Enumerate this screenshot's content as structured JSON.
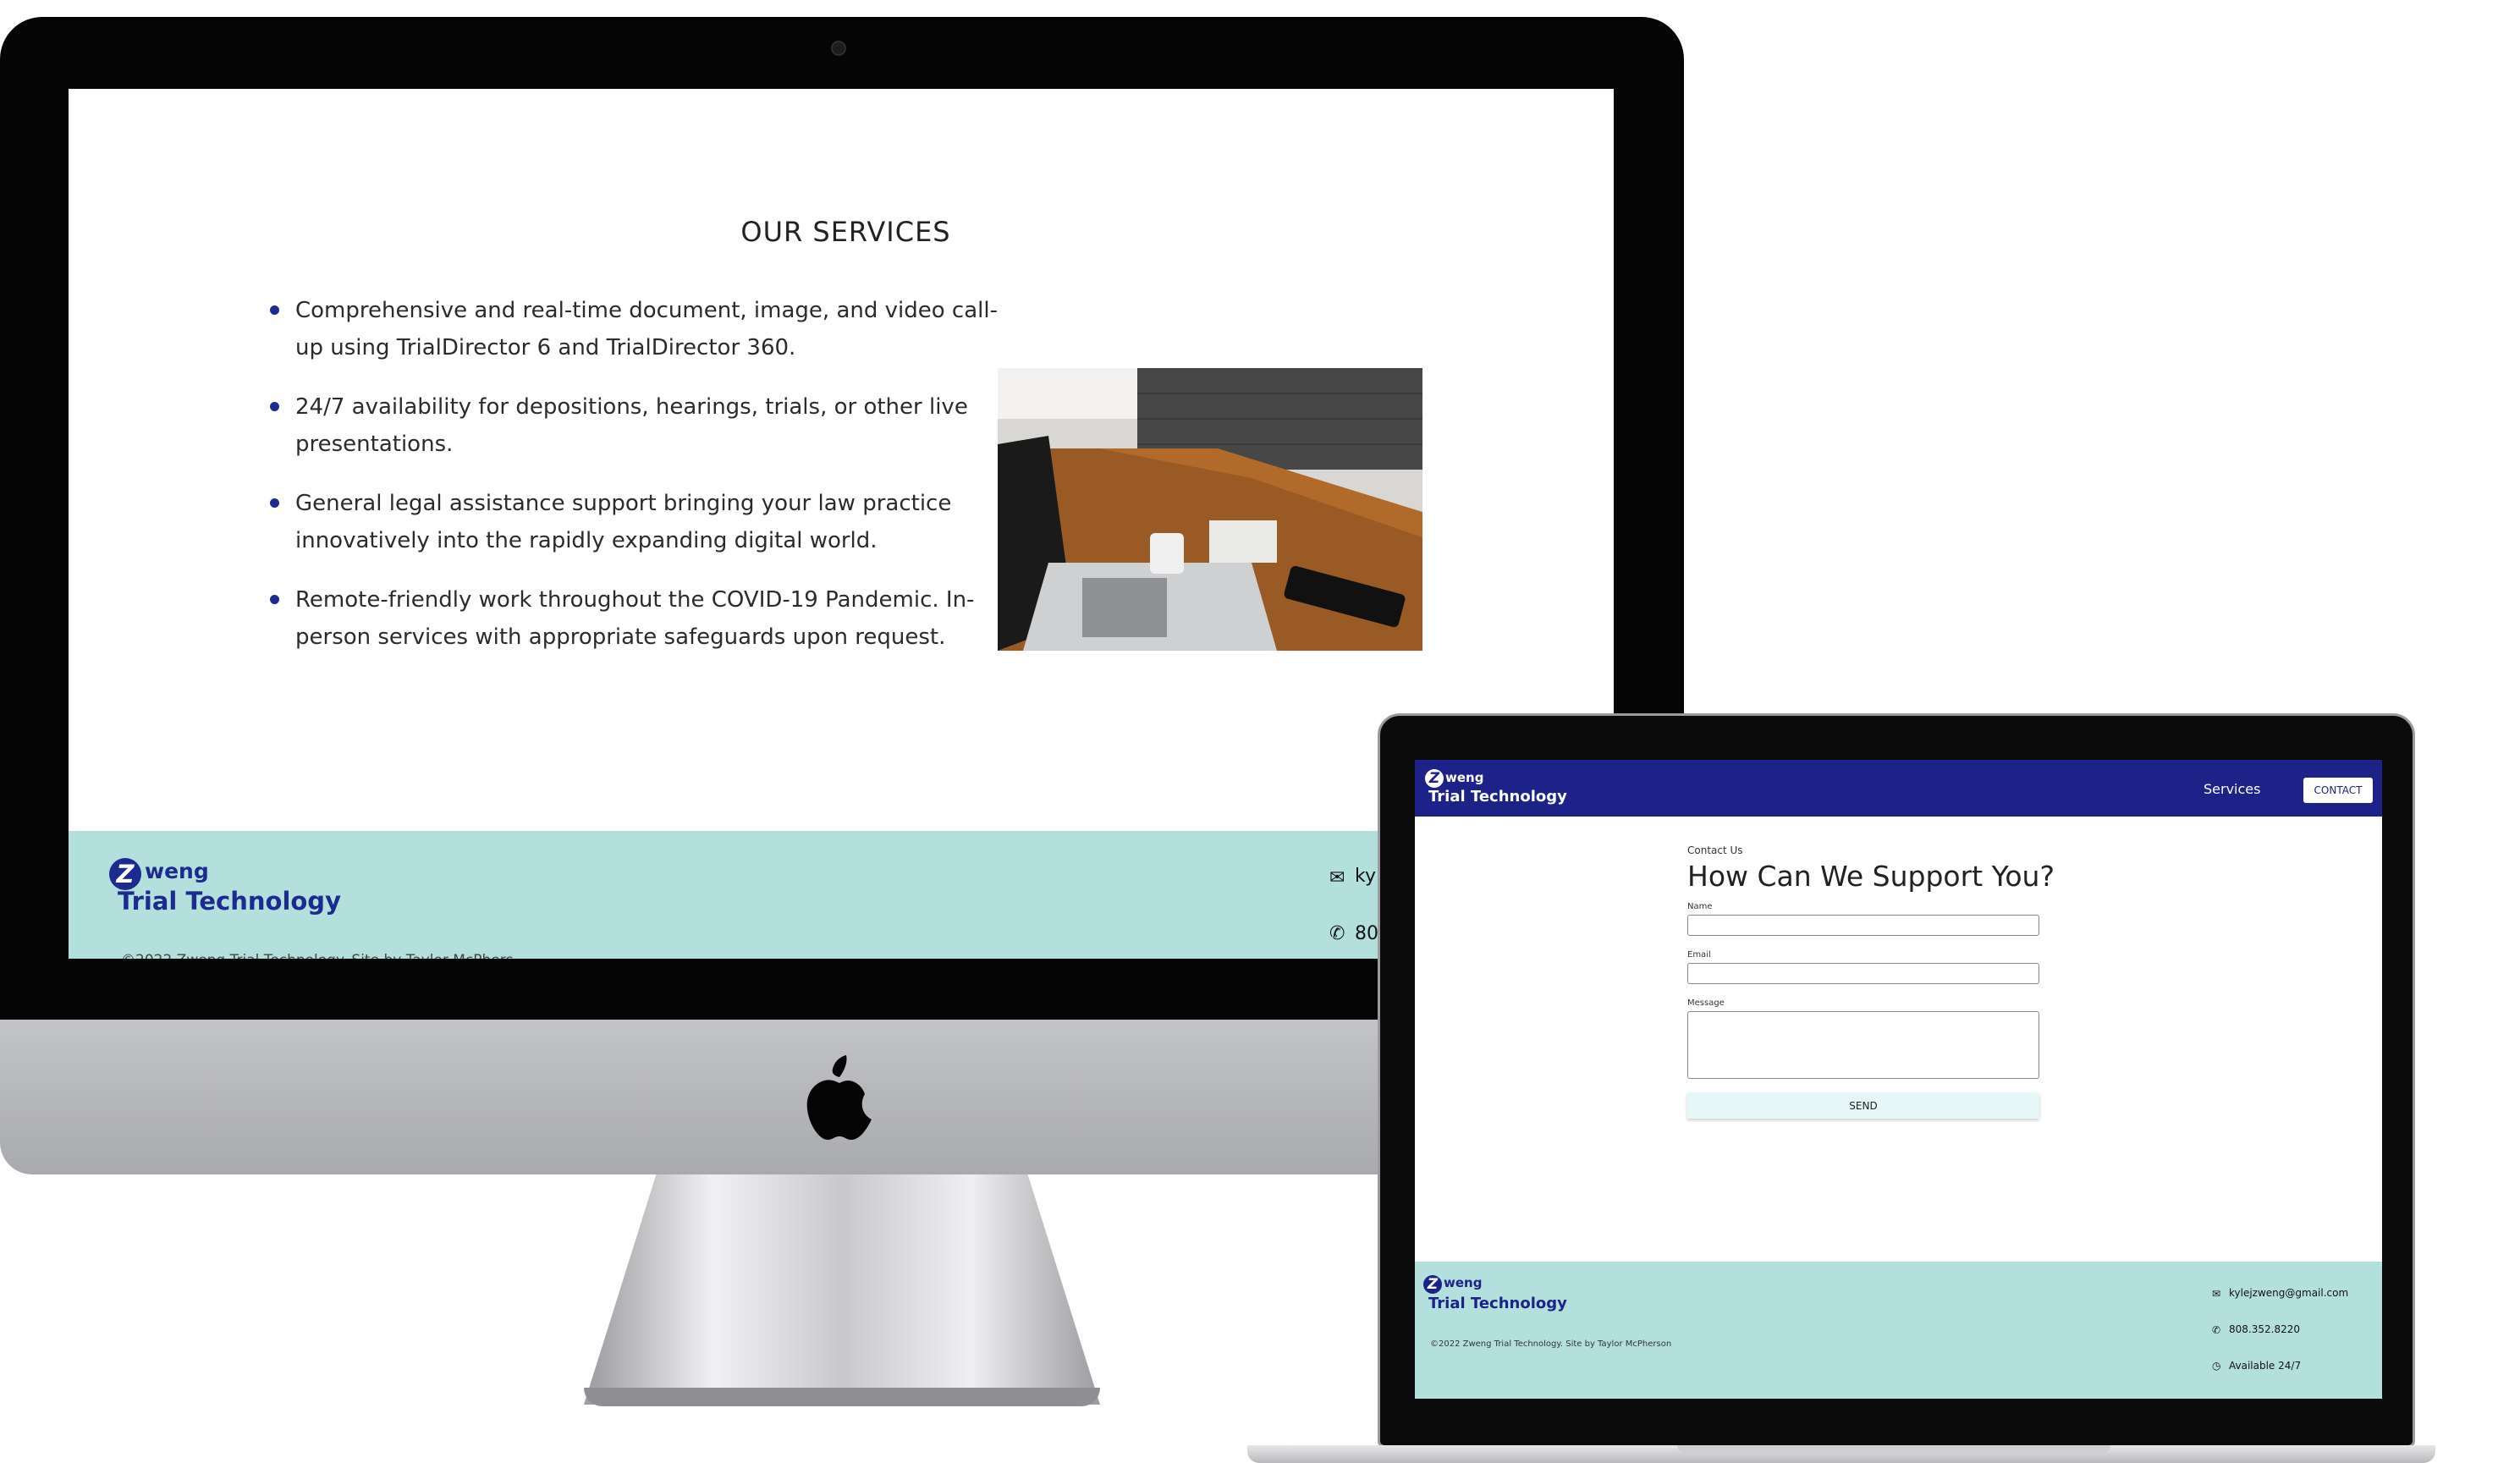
{
  "desktop_site": {
    "services_title": "OUR SERVICES",
    "services": [
      "Comprehensive and real-time document, image, and video call-up using TrialDirector 6 and TrialDirector 360.",
      "24/7 availability for depositions, hearings, trials, or other live presentations.",
      "General legal assistance support bringing your law practice innovatively into the rapidly expanding digital world.",
      "Remote-friendly work throughout the COVID-19 Pandemic. In-person services with appropriate safeguards upon request."
    ],
    "footer": {
      "logo_z": "Z",
      "logo_weng": "weng",
      "logo_sub": "Trial Technology",
      "email_partial": "kyl",
      "phone_partial": "80",
      "copyright_partial": "©2022 Zweng Trial Technology. Site by Taylor McPhers"
    }
  },
  "laptop_site": {
    "nav": {
      "logo_z": "Z",
      "logo_weng": "weng",
      "logo_sub": "Trial Technology",
      "services_link": "Services",
      "contact_button": "CONTACT"
    },
    "form": {
      "eyebrow": "Contact Us",
      "heading": "How Can We Support You?",
      "name_label": "Name",
      "name_value": "",
      "email_label": "Email",
      "email_value": "",
      "message_label": "Message",
      "message_value": "",
      "send_label": "SEND"
    },
    "footer": {
      "logo_z": "Z",
      "logo_weng": "weng",
      "logo_sub": "Trial Technology",
      "copyright": "©2022 Zweng Trial Technology. Site by Taylor McPherson",
      "email": "kylejzweng@gmail.com",
      "phone": "808.352.8220",
      "availability": "Available 24/7"
    }
  },
  "icons": {
    "mail": "envelope-icon",
    "phone": "phone-icon",
    "clock": "clock-icon",
    "apple": "apple-logo-icon"
  },
  "colors": {
    "brand_navy": "#1c2287",
    "footer_teal": "#b3e0dd",
    "send_button": "#e7f7f7"
  }
}
